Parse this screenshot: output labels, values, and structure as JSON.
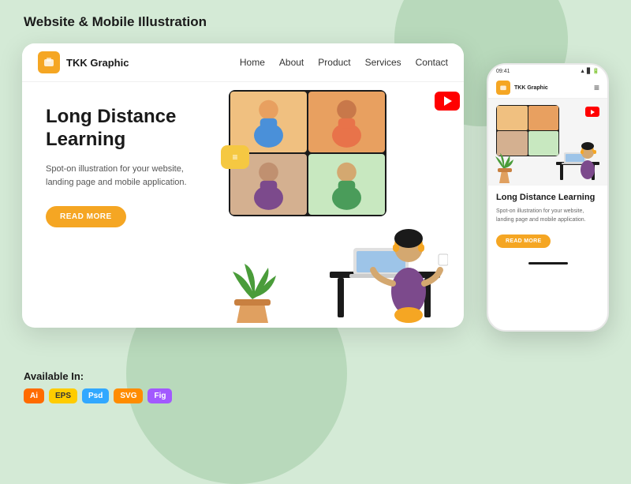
{
  "page": {
    "title": "Website & Mobile Illustration"
  },
  "browser": {
    "brand": "TKK Graphic",
    "nav": {
      "home": "Home",
      "about": "About",
      "product": "Product",
      "services": "Services",
      "contact": "Contact"
    },
    "hero": {
      "title": "Long Distance Learning",
      "subtitle": "Spot-on illustration for your website, landing page and mobile application.",
      "cta": "READ MORE"
    }
  },
  "mobile": {
    "status_time": "09:41",
    "brand": "TKK Graphic",
    "hero": {
      "title": "Long Distance Learning",
      "subtitle": "Spot-on illustration for your website, landing page and mobile application.",
      "cta": "READ MORE"
    }
  },
  "available": {
    "title": "Available In:",
    "formats": [
      "Ai",
      "EPS",
      "Psd",
      "SVG",
      "Fig"
    ]
  }
}
